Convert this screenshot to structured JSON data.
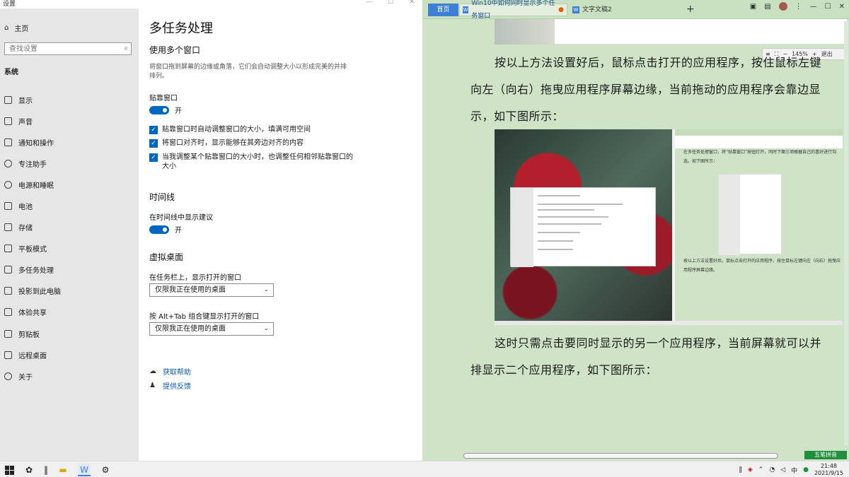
{
  "settings": {
    "window_title": "设置",
    "controls": [
      "—",
      "☐",
      "✕"
    ],
    "sidebar": {
      "home_label": "主页",
      "search_placeholder": "查找设置",
      "section": "系统",
      "items": [
        {
          "label": "显示",
          "icon": "display-icon"
        },
        {
          "label": "声音",
          "icon": "speaker-icon"
        },
        {
          "label": "通知和操作",
          "icon": "notification-icon"
        },
        {
          "label": "专注助手",
          "icon": "moon-icon"
        },
        {
          "label": "电源和睡眠",
          "icon": "power-icon"
        },
        {
          "label": "电池",
          "icon": "battery-icon"
        },
        {
          "label": "存储",
          "icon": "storage-icon"
        },
        {
          "label": "平板模式",
          "icon": "tablet-icon"
        },
        {
          "label": "多任务处理",
          "icon": "multitask-icon"
        },
        {
          "label": "投影到此电脑",
          "icon": "project-icon"
        },
        {
          "label": "体验共享",
          "icon": "share-icon"
        },
        {
          "label": "剪贴板",
          "icon": "clipboard-icon"
        },
        {
          "label": "远程桌面",
          "icon": "remote-icon"
        },
        {
          "label": "关于",
          "icon": "info-icon"
        }
      ]
    },
    "content": {
      "title": "多任务处理",
      "multi_window_heading": "使用多个窗口",
      "multi_window_desc": "将窗口拖到屏幕的边缘或角落，它们会自动调整大小以形成完美的并排排列。",
      "snap_label": "贴靠窗口",
      "snap_toggle": "开",
      "checks": [
        "贴靠窗口时自动调整窗口的大小，填满可用空间",
        "将窗口对齐时，显示能够在其旁边对齐的内容",
        "当我调整某个贴靠窗口的大小时，也调整任何相邻贴靠窗口的大小"
      ],
      "timeline_heading": "时间线",
      "timeline_label": "在时间线中显示建议",
      "timeline_toggle": "开",
      "vdesk_heading": "虚拟桌面",
      "taskbar_label": "在任务栏上，显示打开的窗口",
      "taskbar_value": "仅限我正在使用的桌面",
      "alttab_label": "按 Alt+Tab 组合键显示打开的窗口",
      "alttab_value": "仅限我正在使用的桌面",
      "help_link": "获取帮助",
      "feedback_link": "提供反馈"
    }
  },
  "wps": {
    "tabs": {
      "home": "首页",
      "doc1": "Win10中如何同时显示多个任务窗口",
      "doc2": "文字文稿2"
    },
    "zoom": {
      "percent": "145%",
      "exit": "退出"
    },
    "para1": "按以上方法设置好后，鼠标点击打开的应用程序，按住鼠标左键向左（向右）拖曳应用程序屏幕边缘，当前拖动的应用程序会靠边显示，如下图所示：",
    "para2": "这时只需点击要同时显示的另一个应用程序，当前屏幕就可以并排显示二个应用程序，如下图所示：",
    "inner_text1": "在多任务处理窗口，将“贴靠窗口”按钮打开，同时下面三项根据自己的喜好进行勾选。如下图所示：",
    "inner_text2": "按以上方法设置好后，鼠标点击打开的应用程序，按住鼠标左键向左（向右）拖曳应用程序屏幕边缘。",
    "ime": "五笔拼音"
  },
  "taskbar": {
    "time": "21:48",
    "date": "2021/9/15"
  }
}
